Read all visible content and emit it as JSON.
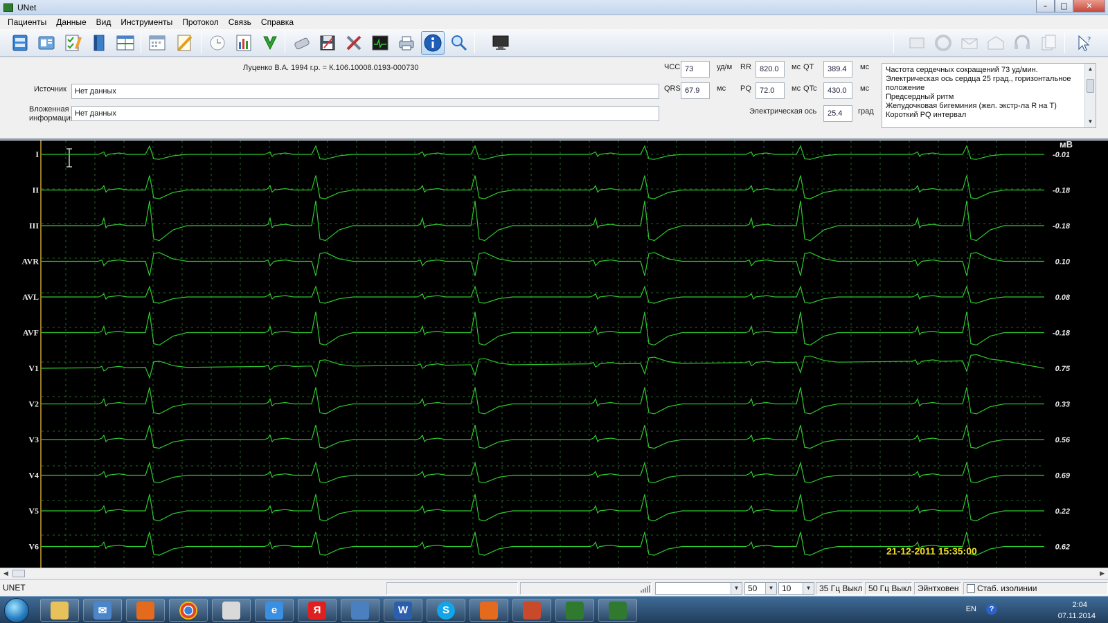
{
  "window": {
    "title": "UNet",
    "controls": [
      "–",
      "□",
      "✕"
    ]
  },
  "menu": [
    "Пациенты",
    "Данные",
    "Вид",
    "Инструменты",
    "Протокол",
    "Связь",
    "Справка"
  ],
  "toolbar": {
    "buttons": [
      "open-records",
      "patient-card",
      "edit-protocol",
      "book",
      "table-view",
      "calendar",
      "ruler",
      "clock",
      "chart-bars",
      "green-arrow",
      "remove",
      "save-disk",
      "tools",
      "monitor-ecg",
      "printer",
      "info",
      "zoom",
      "display"
    ],
    "right_buttons": [
      "book-disabled",
      "sync-disabled",
      "mail-disabled",
      "mail-open-disabled",
      "headset-disabled",
      "documents-disabled",
      "cursor-help"
    ]
  },
  "patient": {
    "header": "Луценко В.А.  1994 г.р.   = К.106.10008.0193-000730"
  },
  "fields": {
    "source_label": "Источник",
    "source_value": "Нет данных",
    "attached_label_1": "Вложенная",
    "attached_label_2": "информация",
    "attached_value": "Нет данных"
  },
  "measurements": {
    "hr_label": "ЧСС",
    "hr_value": "73",
    "hr_unit": "уд/м",
    "rr_label": "RR",
    "rr_value": "820.0",
    "rr_unit": "мс",
    "qt_label": "QT",
    "qt_value": "389.4",
    "qt_unit": "мс",
    "qrs_label": "QRS",
    "qrs_value": "67.9",
    "qrs_unit": "мс",
    "pq_label": "PQ",
    "pq_value": "72.0",
    "pq_unit": "мс",
    "qtc_label": "QTc",
    "qtc_value": "430.0",
    "qtc_unit": "мс",
    "axis_label": "Электрическая ось",
    "axis_value": "25.4",
    "axis_unit": "град"
  },
  "conclusion": [
    "Частота сердечных сокращений 73 уд/мин.",
    "Электрическая ось сердца 25 град., горизонтальное",
    "положение",
    "Предсердный ритм",
    "Желудочковая бигеминия (жел. экстр-ла R на T)",
    "Короткий PQ интервал"
  ],
  "ecg": {
    "unit": "мВ",
    "timestamp": "21-12-2011 15:35:00",
    "trace_color": "#2fc92f",
    "leads": [
      {
        "name": "I",
        "value": "-0.01"
      },
      {
        "name": "II",
        "value": "-0.18"
      },
      {
        "name": "III",
        "value": "-0.18"
      },
      {
        "name": "AVR",
        "value": "0.10"
      },
      {
        "name": "AVL",
        "value": "0.08"
      },
      {
        "name": "AVF",
        "value": "-0.18"
      },
      {
        "name": "V1",
        "value": "0.75"
      },
      {
        "name": "V2",
        "value": "0.33"
      },
      {
        "name": "V3",
        "value": "0.56"
      },
      {
        "name": "V4",
        "value": "0.69"
      },
      {
        "name": "V5",
        "value": "0.22"
      },
      {
        "name": "V6",
        "value": "0.62"
      }
    ]
  },
  "status": {
    "app": "UNET",
    "speed": "50",
    "gain": "10",
    "filter_35": "35 Гц Выкл.",
    "filter_50": "50 Гц Выкл.",
    "leads_system": "Эйнтховен",
    "isoline": "Стаб. изолинии"
  },
  "taskbar": {
    "apps": [
      "explorer",
      "mail",
      "office",
      "chrome",
      "photo",
      "ie",
      "yandex",
      "media",
      "word",
      "skype",
      "office2",
      "powerpoint",
      "unet",
      "unet2"
    ],
    "lang": "EN",
    "time": "2:04",
    "date": "07.11.2014"
  }
}
